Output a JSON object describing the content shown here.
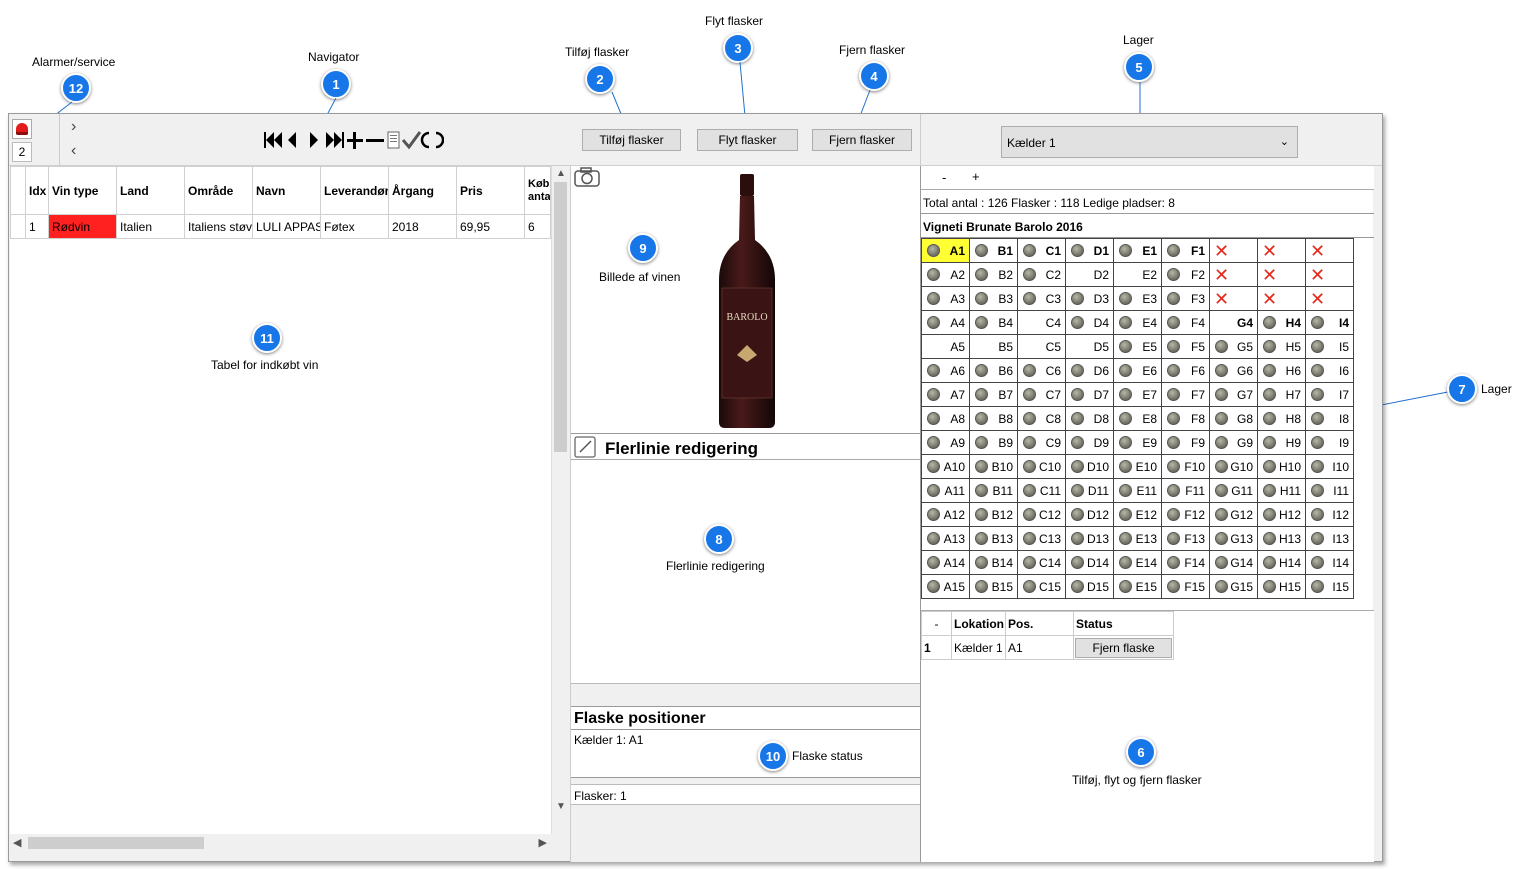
{
  "callouts": [
    {
      "num": "12",
      "label": "Alarmer/service"
    },
    {
      "num": "1",
      "label": "Navigator"
    },
    {
      "num": "2",
      "label": "Tilføj flasker"
    },
    {
      "num": "3",
      "label": "Flyt flasker"
    },
    {
      "num": "4",
      "label": "Fjern flasker"
    },
    {
      "num": "5",
      "label": "Lager"
    },
    {
      "num": "9",
      "label": "Billede af vinen"
    },
    {
      "num": "11",
      "label": "Tabel for indkøbt vin"
    },
    {
      "num": "8",
      "label": "Flerlinie redigering"
    },
    {
      "num": "7",
      "label": "Lager"
    },
    {
      "num": "10",
      "label": "Flaske status"
    },
    {
      "num": "6",
      "label": "Tilføj, flyt og fjern flasker"
    }
  ],
  "toolbar": {
    "alarm_count": "2",
    "nav_right": "›",
    "nav_left": "‹",
    "btn_add": "Tilføj flasker",
    "btn_move": "Flyt flasker",
    "btn_remove": "Fjern flasker",
    "storage_select": "Kælder 1"
  },
  "wine_table": {
    "headers": [
      "Idx",
      "Vin type",
      "Land",
      "Område",
      "Navn",
      "Leverandør",
      "Årgang",
      "Pris",
      "Køb antal"
    ],
    "row": [
      "1",
      "Rødvin",
      "Italien",
      "Italiens støvl",
      "LULI APPASS",
      "Føtex",
      "2018",
      "69,95",
      "6"
    ]
  },
  "middle": {
    "multiline_title": "Flerlinie redigering",
    "positions_title": "Flaske positioner",
    "positions_text": "Kælder 1: A1",
    "count_text": "Flasker: 1"
  },
  "cellar": {
    "zoom_minus": "-",
    "zoom_plus": "+",
    "totals": "Total antal : 126  Flasker : 118  Ledige pladser: 8",
    "wine_name": "Vigneti Brunate Barolo 2016",
    "cols": [
      "A",
      "B",
      "C",
      "D",
      "E",
      "F",
      "G",
      "H",
      "I"
    ],
    "rows": 15
  },
  "locations": {
    "headers": [
      "-",
      "Lokation",
      "Pos.",
      "Status"
    ],
    "row": [
      "1",
      "Kælder 1",
      "A1"
    ],
    "remove_btn": "Fjern flaske"
  },
  "colors": {
    "callout": "#1877e8",
    "red_cell": "#ff2020",
    "selected": "#ffff33"
  }
}
